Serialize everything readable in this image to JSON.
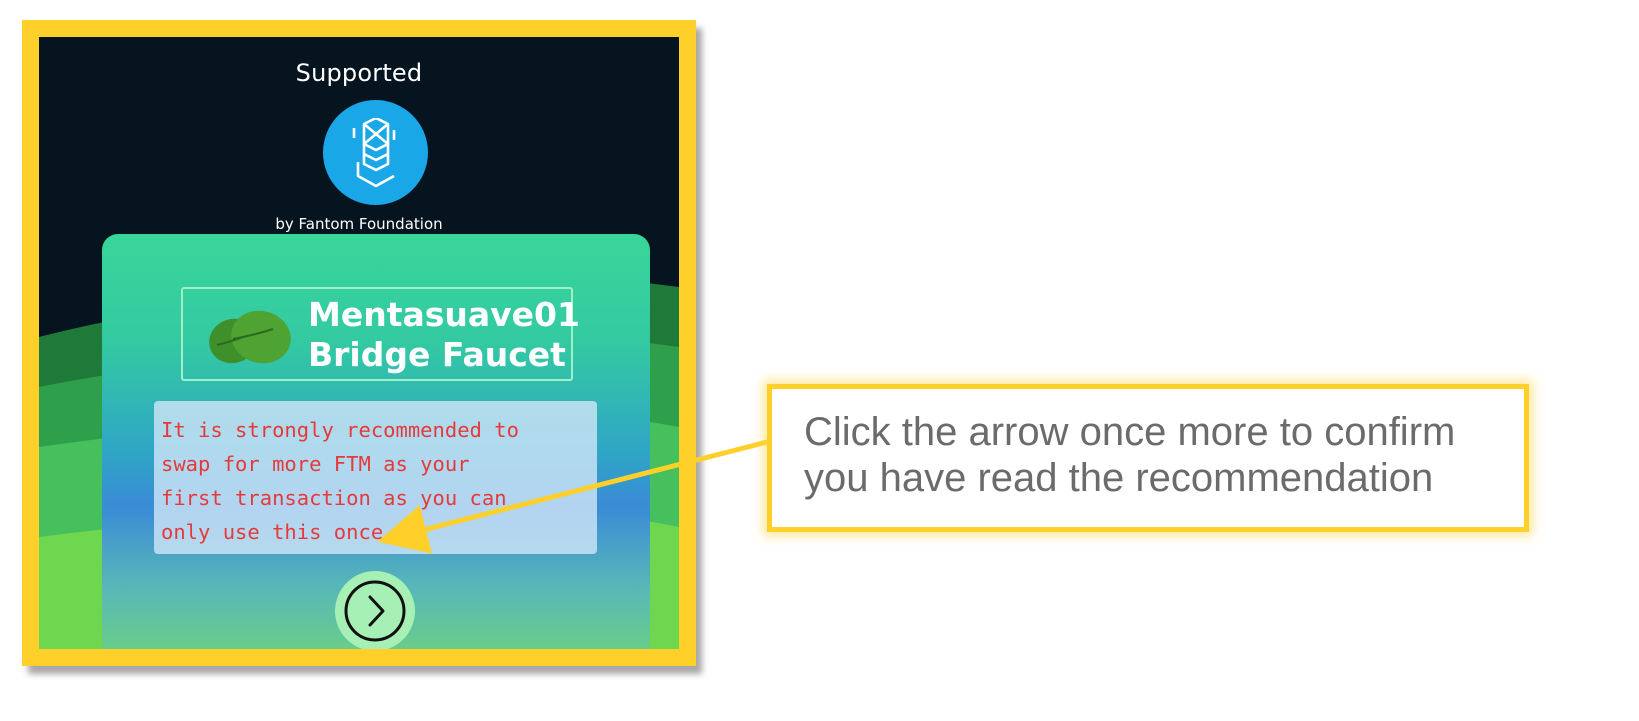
{
  "screenshot": {
    "supported_label": "Supported",
    "by_line": "by Fantom Foundation",
    "card": {
      "title_line1": "Mentasuave01",
      "title_line2": "Bridge Faucet",
      "notice_lines": [
        "It is strongly recommended to",
        "swap for more FTM as your",
        "first transaction as you can",
        "only use this once"
      ]
    }
  },
  "callout": {
    "text_line1": "Click the arrow once more to confirm",
    "text_line2": "you have read the recommendation"
  },
  "colors": {
    "frame": "#ffd02a",
    "fantom_blue": "#1aa7e8",
    "notice_text": "#e53a3a",
    "callout_text": "#6b6b6b"
  },
  "icons": {
    "logo": "fantom-logo-icon",
    "leaf": "mint-leaf-icon",
    "next": "chevron-right-circle-icon"
  }
}
